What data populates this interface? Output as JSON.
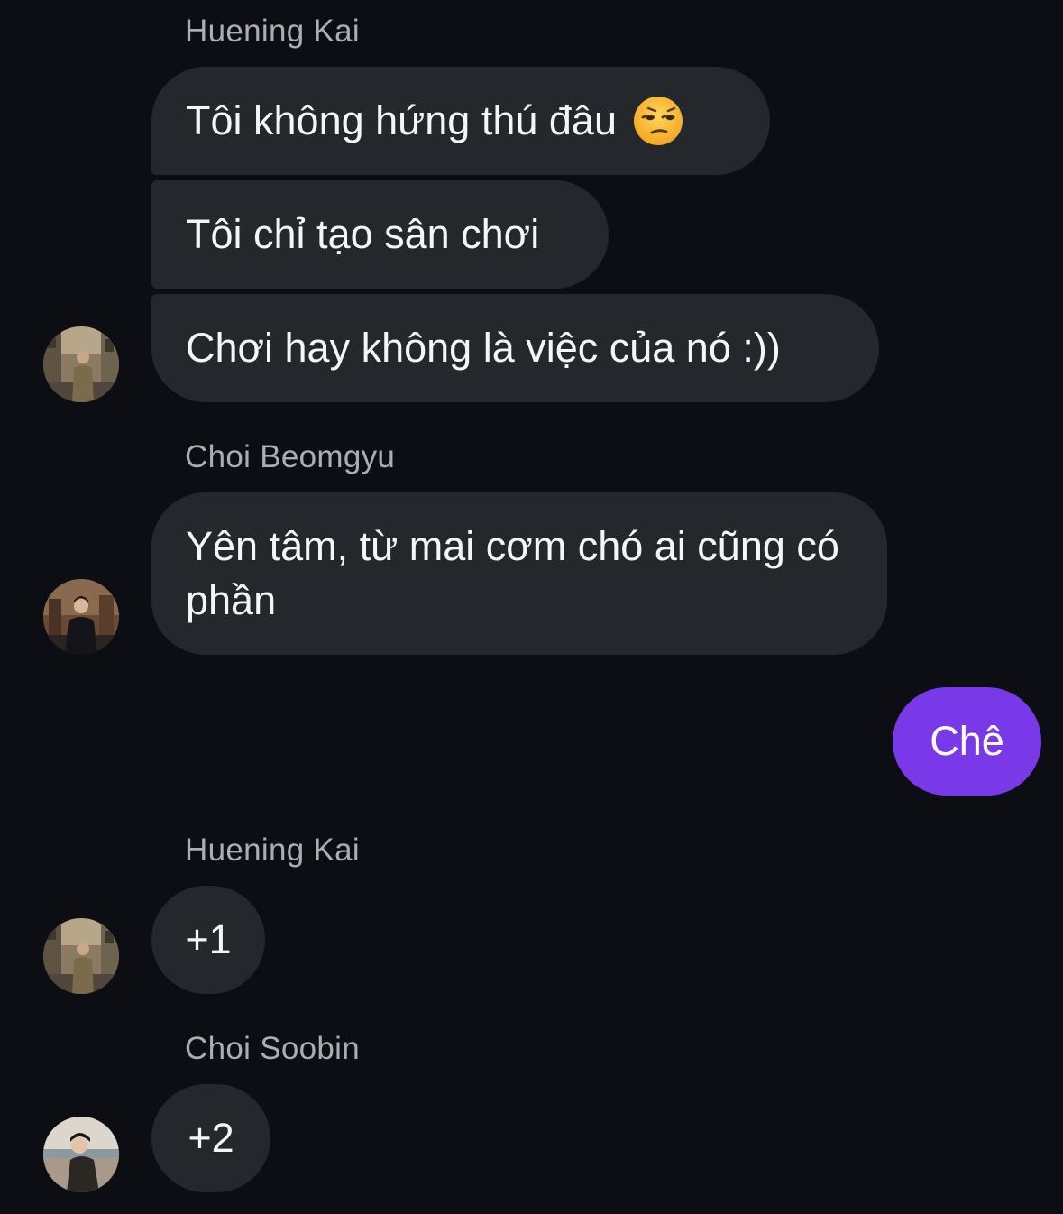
{
  "conversation": {
    "groups": [
      {
        "sender": "Huening Kai",
        "messages": [
          "Tôi không hứng thú đâu",
          "Tôi chỉ tạo sân chơi",
          "Chơi hay không là việc của nó :))"
        ],
        "emoji_on_first": "unamused-face-emoji"
      },
      {
        "sender": "Choi Beomgyu",
        "messages": [
          "Yên tâm, từ mai cơm chó ai cũng có phần"
        ]
      },
      {
        "sender": "",
        "outgoing": true,
        "messages": [
          "Chê"
        ]
      },
      {
        "sender": "Huening Kai",
        "messages": [
          "+1"
        ]
      },
      {
        "sender": "Choi Soobin",
        "messages": [
          "+2"
        ]
      }
    ]
  },
  "colors": {
    "background": "#0c0e13",
    "incoming_bubble": "#24272c",
    "outgoing_bubble": "#7a39e8",
    "sender_name": "#a9adb5"
  }
}
